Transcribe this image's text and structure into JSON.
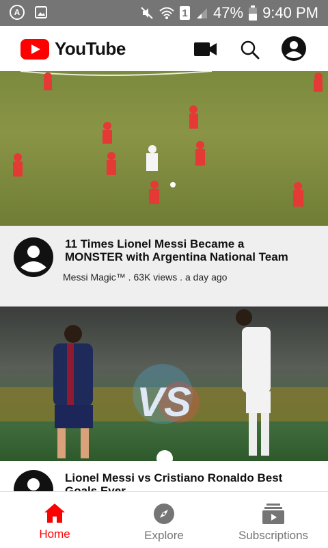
{
  "status_bar": {
    "left_icons": [
      "accessibility-icon",
      "image-icon"
    ],
    "sim": "1",
    "battery": "47%",
    "time": "9:40 PM"
  },
  "header": {
    "brand": "YouTube",
    "icons": [
      "camera-icon",
      "search-icon",
      "account-icon"
    ],
    "brand_color": "#ff0000"
  },
  "feed": {
    "videos": [
      {
        "title": "11 Times Lionel Messi Became a MONSTER with Argentina National Team",
        "meta": "Messi Magic™ . 63K views . a day ago"
      },
      {
        "title": "Lionel Messi vs Cristiano Ronaldo Best Goals Ever",
        "thumbnail_text": "VS"
      }
    ]
  },
  "bottom_nav": {
    "items": [
      {
        "label": "Home",
        "icon": "home-icon",
        "active": true
      },
      {
        "label": "Explore",
        "icon": "compass-icon",
        "active": false
      },
      {
        "label": "Subscriptions",
        "icon": "subscriptions-icon",
        "active": false
      }
    ],
    "active_color": "#ff0000",
    "inactive_color": "#757575"
  }
}
